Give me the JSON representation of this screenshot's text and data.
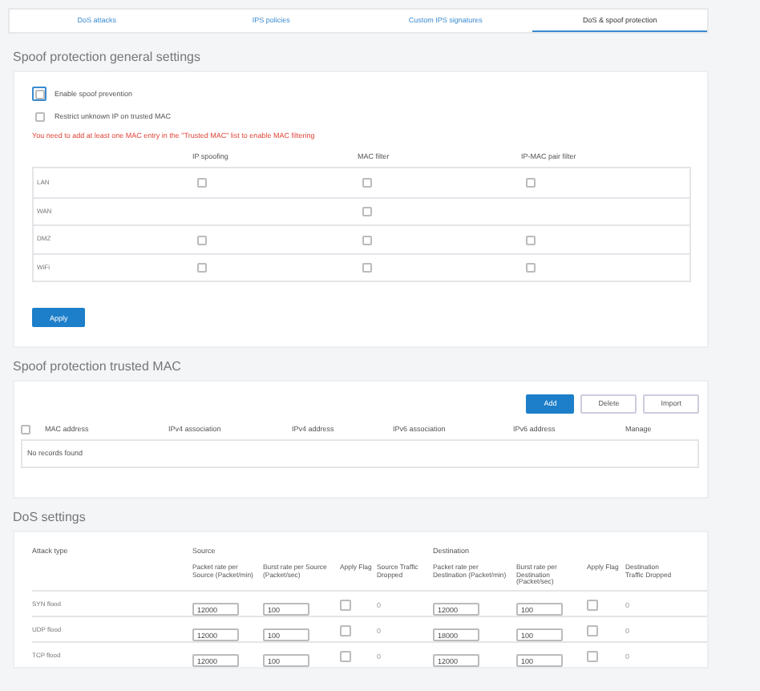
{
  "tabs": [
    {
      "label": "DoS attacks",
      "selected": false
    },
    {
      "label": "IPS policies",
      "selected": false
    },
    {
      "label": "Custom IPS signatures",
      "selected": false
    },
    {
      "label": "DoS & spoof protection",
      "selected": true
    }
  ],
  "spoof_general": {
    "title": "Spoof protection general settings",
    "options": [
      {
        "label": "Enable spoof prevention",
        "checked": false,
        "focused": true
      },
      {
        "label": "Restrict unknown IP on trusted MAC",
        "checked": false,
        "focused": false
      }
    ],
    "warning": "You need to add at least one MAC entry in the \"Trusted MAC\" list to enable MAC filtering",
    "columns": [
      "IP spoofing",
      "MAC filter",
      "IP-MAC pair filter"
    ],
    "rows": [
      {
        "zone": "LAN",
        "cells": [
          {
            "kind": "checkbox",
            "checked": false
          },
          {
            "kind": "checkbox",
            "checked": false
          },
          {
            "kind": "checkbox",
            "checked": false
          }
        ]
      },
      {
        "zone": "WAN",
        "cells": [
          {
            "kind": "empty"
          },
          {
            "kind": "checkbox",
            "checked": false
          },
          {
            "kind": "empty"
          }
        ]
      },
      {
        "zone": "DMZ",
        "cells": [
          {
            "kind": "checkbox",
            "checked": false
          },
          {
            "kind": "checkbox",
            "checked": false
          },
          {
            "kind": "checkbox",
            "checked": false
          }
        ]
      },
      {
        "zone": "WiFi",
        "cells": [
          {
            "kind": "checkbox",
            "checked": false
          },
          {
            "kind": "checkbox",
            "checked": false
          },
          {
            "kind": "checkbox",
            "checked": false
          }
        ]
      }
    ],
    "apply": "Apply"
  },
  "trusted_mac": {
    "title": "Spoof protection trusted MAC",
    "buttons": [
      {
        "label": "Add",
        "primary": true
      },
      {
        "label": "Delete",
        "primary": false
      },
      {
        "label": "Import",
        "primary": false
      }
    ],
    "select_all_checked": false,
    "columns": [
      "MAC address",
      "IPv4 association",
      "IPv4 address",
      "IPv6 association",
      "IPv6 address",
      "Manage"
    ],
    "empty_message": "No records found"
  },
  "dos": {
    "title": "DoS settings",
    "attack_type_header": "Attack type",
    "source_header": "Source",
    "destination_header": "Destination",
    "columns": [
      "Packet rate per Source (Packet/min)",
      "Burst rate per Source (Packet/sec)",
      "Apply Flag",
      "Source Traffic Dropped",
      "Packet rate per Destination (Packet/min)",
      "Burst rate per Destination (Packet/sec)",
      "Apply Flag",
      "Destination Traffic Dropped"
    ],
    "rows": [
      {
        "attack": "SYN flood",
        "src_packet_rate": "12000",
        "src_burst_rate": "100",
        "src_apply": false,
        "src_dropped": "0",
        "dst_packet_rate": "12000",
        "dst_burst_rate": "100",
        "dst_apply": false,
        "dst_dropped": "0"
      },
      {
        "attack": "UDP flood",
        "src_packet_rate": "12000",
        "src_burst_rate": "100",
        "src_apply": false,
        "src_dropped": "0",
        "dst_packet_rate": "18000",
        "dst_burst_rate": "100",
        "dst_apply": false,
        "dst_dropped": "0"
      },
      {
        "attack": "TCP flood",
        "src_packet_rate": "12000",
        "src_burst_rate": "100",
        "src_apply": false,
        "src_dropped": "0",
        "dst_packet_rate": "12000",
        "dst_burst_rate": "100",
        "dst_apply": false,
        "dst_dropped": "0"
      }
    ]
  }
}
